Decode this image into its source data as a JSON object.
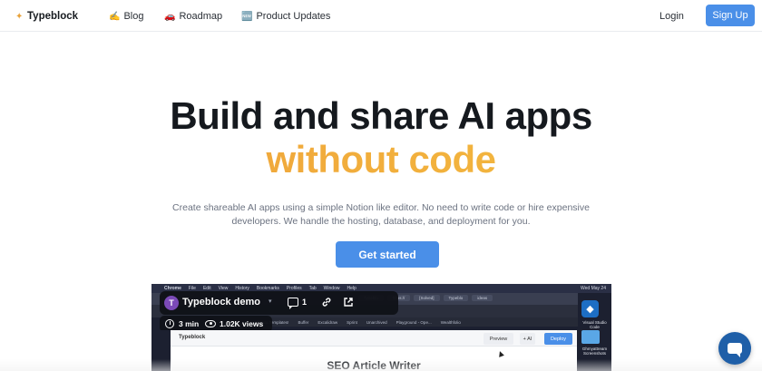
{
  "nav": {
    "brand": "Typeblock",
    "brand_icon": "sparkle-icon",
    "links": [
      {
        "icon": "✍️",
        "label": "Blog"
      },
      {
        "icon": "🚗",
        "label": "Roadmap"
      },
      {
        "icon": "🆕",
        "label": "Product Updates"
      }
    ],
    "login": "Login",
    "signup": "Sign Up"
  },
  "hero": {
    "title_line1": "Build and share AI apps",
    "title_line2": "without code",
    "subtitle": "Create shareable AI apps using a simple Notion like editor. No need to write code or hire expensive developers. We handle the hosting, database, and deployment for you.",
    "cta": "Get started"
  },
  "demo": {
    "menubar_items": [
      "Chrome",
      "File",
      "Edit",
      "View",
      "History",
      "Bookmarks",
      "Profiles",
      "Tab",
      "Window",
      "Help"
    ],
    "menubar_right": "Wed May 24",
    "tabs": [
      "Typeblo",
      "https://",
      "[Solved]",
      "Typeblo",
      "ideas"
    ],
    "bookmarks": [
      "Chakra Templates!",
      "Buffer",
      "Excalidraw",
      "Sprint",
      "Unarchived",
      "Playground - Ope...",
      "Wealthfolio"
    ],
    "video": {
      "avatar_letter": "T",
      "title": "Typeblock demo",
      "comments": "1",
      "duration": "3 min",
      "views": "1.02K views"
    },
    "app": {
      "title": "Typeblock",
      "preview": "Preview",
      "ai": "+ AI",
      "deploy": "Deploy",
      "heading": "SEO Article Writer"
    },
    "dock": {
      "vscode_label": "Visual Studio Code",
      "folder_label": "Ghmyattream Screenshots"
    }
  },
  "colors": {
    "primary": "#4a8fe8",
    "gradient_start": "#ee9d3a",
    "gradient_end": "#f4c043",
    "chat_bubble": "#1f5fa8"
  }
}
